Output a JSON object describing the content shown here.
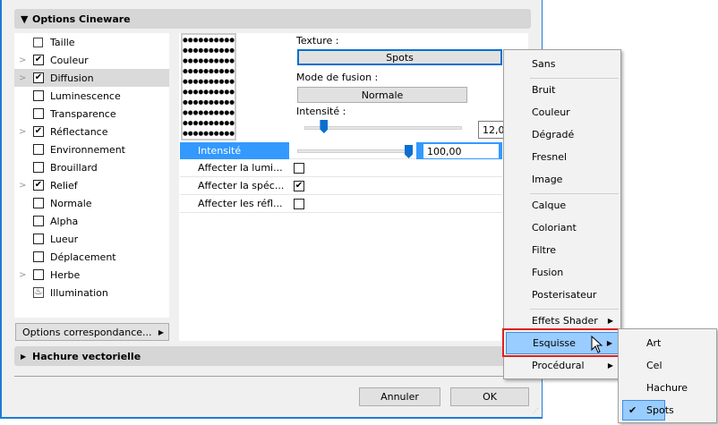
{
  "sections": {
    "cineware": "Options Cineware",
    "hatch": "Hachure vectorielle"
  },
  "channels": [
    {
      "label": "Taille",
      "icon": "size-icon",
      "checked": null,
      "expand": false
    },
    {
      "label": "Couleur",
      "checked": true,
      "expand": true
    },
    {
      "label": "Diffusion",
      "checked": true,
      "expand": true,
      "selected": true
    },
    {
      "label": "Luminescence",
      "checked": false,
      "expand": false
    },
    {
      "label": "Transparence",
      "checked": false,
      "expand": false
    },
    {
      "label": "Réflectance",
      "checked": true,
      "expand": true
    },
    {
      "label": "Environnement",
      "checked": false,
      "expand": false
    },
    {
      "label": "Brouillard",
      "checked": false,
      "expand": false
    },
    {
      "label": "Relief",
      "checked": true,
      "expand": true
    },
    {
      "label": "Normale",
      "checked": false,
      "expand": false
    },
    {
      "label": "Alpha",
      "checked": false,
      "expand": false
    },
    {
      "label": "Lueur",
      "checked": false,
      "expand": false
    },
    {
      "label": "Déplacement",
      "checked": false,
      "expand": false
    },
    {
      "label": "Herbe",
      "checked": false,
      "expand": true
    },
    {
      "label": "Illumination",
      "icon": "illumination-icon",
      "checked": null,
      "expand": false
    }
  ],
  "match_options": "Options correspondance...",
  "texture": {
    "label": "Texture :",
    "value": "Spots"
  },
  "blend": {
    "label": "Mode de fusion :",
    "value": "Normale"
  },
  "intensity": {
    "label": "Intensité :",
    "value": "12,00",
    "fraction": 0.12
  },
  "props": {
    "intensity": {
      "label": "Intensité",
      "value": "100,00",
      "fraction": 1.0
    },
    "rows": [
      {
        "label": "Affecter la lumi...",
        "checked": false
      },
      {
        "label": "Affecter la spéc...",
        "checked": true
      },
      {
        "label": "Affecter les réfl...",
        "checked": false
      }
    ]
  },
  "buttons": {
    "cancel": "Annuler",
    "ok": "OK"
  },
  "menu": {
    "groups": [
      [
        "Sans"
      ],
      [
        "Bruit",
        "Couleur",
        "Dégradé",
        "Fresnel",
        "Image"
      ],
      [
        "Calque",
        "Coloriant",
        "Filtre",
        "Fusion",
        "Posterisateur"
      ],
      [
        "Effets Shader",
        "Esquisse",
        "Procédural"
      ]
    ],
    "highlighted": "Esquisse",
    "submenu": [
      "Art",
      "Cel",
      "Hachure",
      "Spots"
    ],
    "submenu_checked": "Spots"
  },
  "colors": {
    "accent": "#1e7ad8",
    "highlight": "#99ccff",
    "selection": "#3399ff",
    "callout": "#e02020"
  }
}
